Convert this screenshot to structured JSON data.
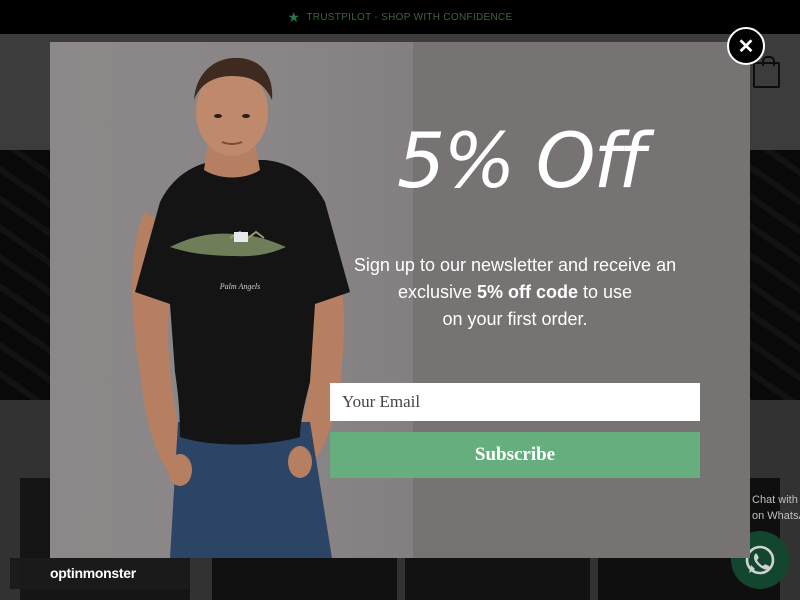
{
  "topbar": {
    "star_icon": "star-icon",
    "text": "TRUSTPILOT - SHOP WITH CONFIDENCE",
    "color": "#4a7a4a"
  },
  "header": {
    "cart_icon": "shopping-bag-icon"
  },
  "chat_widget": {
    "label": "Chat with us\non WhatsApp",
    "icon": "whatsapp-icon",
    "color": "#18563a"
  },
  "popup": {
    "headline": "5% Off",
    "body_line1": "Sign up to our newsletter and receive an",
    "body_line2_pre": "exclusive ",
    "body_line2_bold": "5% off code",
    "body_line2_post": " to use",
    "body_line3": "on your first order.",
    "email_placeholder": "Your Email",
    "subscribe_label": "Subscribe",
    "subscribe_color": "#67ae7e",
    "background_color": "#777373",
    "close_icon": "close-icon",
    "shirt_print": "Palm Angels"
  },
  "branding": {
    "logo_text": "optinmonster"
  }
}
